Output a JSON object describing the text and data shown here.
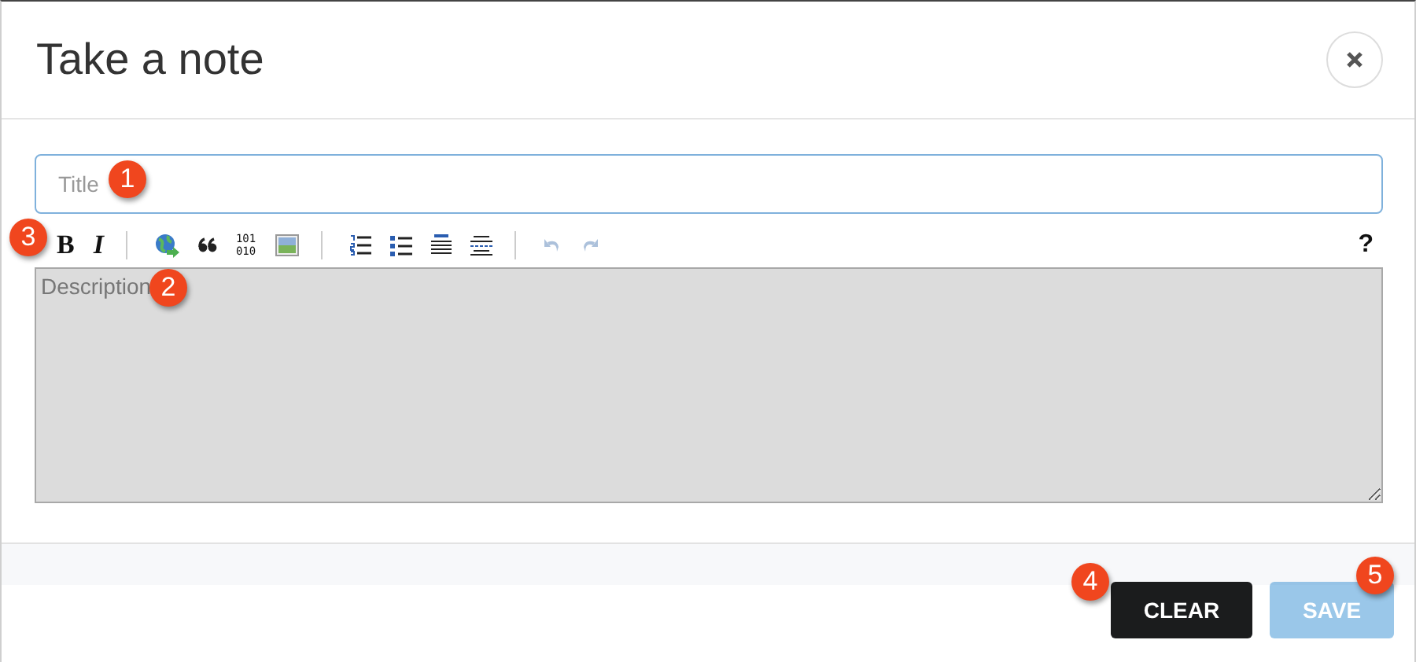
{
  "dialog": {
    "title": "Take a note"
  },
  "title_field": {
    "placeholder": "Title",
    "callout": "1"
  },
  "toolbar": {
    "callout": "3",
    "groups": [
      [
        {
          "kind": "bold",
          "text": "B"
        },
        {
          "kind": "italic",
          "text": "I"
        }
      ],
      [
        {
          "kind": "link"
        },
        {
          "kind": "quote"
        },
        {
          "kind": "code",
          "text": "101\n010"
        },
        {
          "kind": "image"
        }
      ],
      [
        {
          "kind": "olist"
        },
        {
          "kind": "ulist"
        },
        {
          "kind": "heading"
        },
        {
          "kind": "rule"
        }
      ],
      [
        {
          "kind": "undo",
          "disabled": true
        },
        {
          "kind": "redo",
          "disabled": true
        }
      ]
    ],
    "help": "?"
  },
  "description_field": {
    "placeholder": "Description",
    "callout": "2"
  },
  "buttons": [
    {
      "label": "CLEAR",
      "kind": "dark",
      "disabled": false,
      "callout": "4"
    },
    {
      "label": "SAVE",
      "kind": "primary",
      "disabled": true,
      "callout": "5"
    }
  ]
}
